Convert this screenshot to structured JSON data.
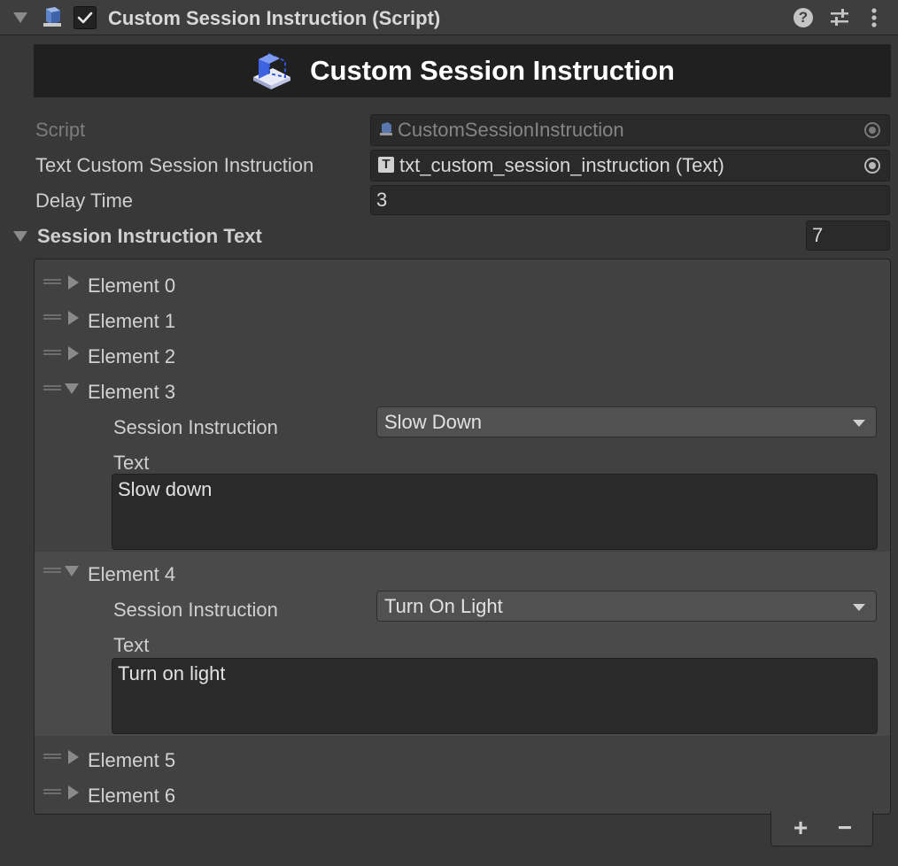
{
  "header": {
    "title": "Custom Session Instruction (Script)",
    "enabled": true,
    "help_icon": "help-icon",
    "presets_icon": "presets-icon",
    "menu_icon": "more-vert-icon"
  },
  "banner": {
    "title": "Custom Session Instruction",
    "icon": "cube-logo-icon"
  },
  "fields": {
    "script_label": "Script",
    "script_value": "CustomSessionInstruction",
    "text_label": "Text Custom Session Instruction",
    "text_type_glyph": "T",
    "text_value": "txt_custom_session_instruction (Text)",
    "delay_label": "Delay Time",
    "delay_value": "3"
  },
  "list": {
    "label": "Session Instruction Text",
    "size": "7",
    "elements": [
      {
        "label": "Element 0",
        "expanded": false
      },
      {
        "label": "Element 1",
        "expanded": false
      },
      {
        "label": "Element 2",
        "expanded": false
      },
      {
        "label": "Element 3",
        "expanded": true,
        "instruction_label": "Session Instruction",
        "instruction_value": "Slow Down",
        "text_label": "Text",
        "text_value": "Slow down"
      },
      {
        "label": "Element 4",
        "expanded": true,
        "instruction_label": "Session Instruction",
        "instruction_value": "Turn On Light",
        "text_label": "Text",
        "text_value": "Turn on light"
      },
      {
        "label": "Element 5",
        "expanded": false
      },
      {
        "label": "Element 6",
        "expanded": false
      }
    ],
    "add_label": "+",
    "remove_label": "−"
  },
  "colors": {
    "background": "#383838",
    "banner": "#202020",
    "field": "#2a2a2a",
    "selected_row": "#4a4a4a"
  }
}
